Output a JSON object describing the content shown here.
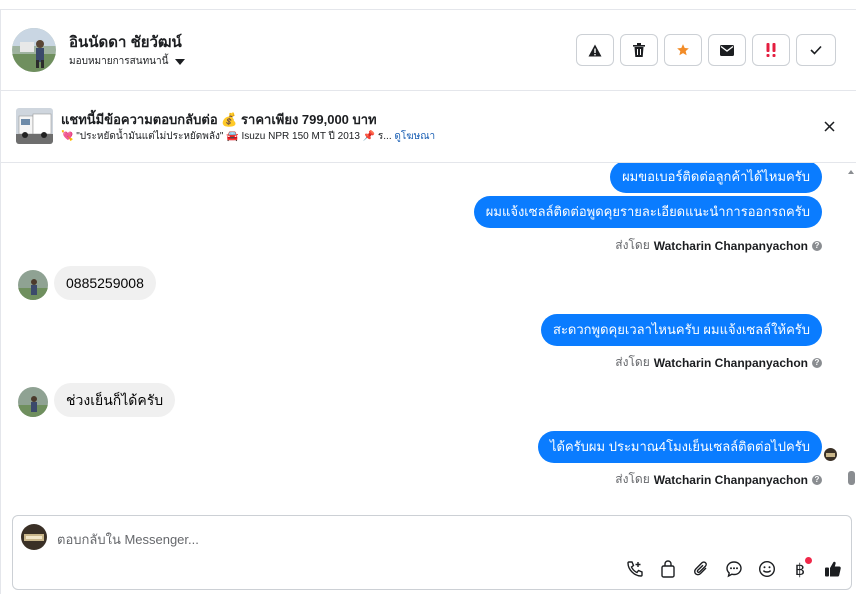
{
  "header": {
    "contact_name": "อินนัดดา ชัยวัฒน์",
    "assign_label": "มอบหมายการสนทนานี้",
    "actions": [
      {
        "name": "report-spam-button",
        "icon": "warning-icon"
      },
      {
        "name": "delete-button",
        "icon": "trash-icon"
      },
      {
        "name": "star-button",
        "icon": "star-icon"
      },
      {
        "name": "mark-unread-button",
        "icon": "envelope-icon"
      },
      {
        "name": "follow-up-button",
        "icon": "double-exclamation-icon"
      },
      {
        "name": "mark-done-button",
        "icon": "checkmark-icon"
      }
    ]
  },
  "ad": {
    "title": "แชทนี้มีข้อความตอบกลับต่อ 💰 ราคาเพียง 799,000 บาท",
    "subtitle": "💘 \"ประหยัดน้ำมันแต่ไม่ประหยัดพลัง\" 🚘 Isuzu NPR 150 MT ปี 2013 📌 ร...",
    "link": "ดูโฆษณา"
  },
  "messages": [
    {
      "direction": "out",
      "text": "ผมขอเบอร์ติดต่อลูกค้าได้ไหมครับ"
    },
    {
      "direction": "out",
      "text": "ผมแจ้งเซลล์ติดต่อพูดคุยรายละเอียดแนะนำการออกรถครับ"
    },
    {
      "direction": "in",
      "text": "0885259008"
    },
    {
      "direction": "out",
      "text": "สะดวกพูดคุยเวลาไหนครับ ผมแจ้งเซลล์ให้ครับ"
    },
    {
      "direction": "in",
      "text": "ช่วงเย็นก็ได้ครับ"
    },
    {
      "direction": "out",
      "text": "ได้ครับผม ประมาณ4โมงเย็นเซลล์ติดต่อไปครับ"
    }
  ],
  "sent_by": {
    "prefix": "ส่งโดย",
    "name": "Watcharin Chanpanyachon"
  },
  "composer": {
    "placeholder": "ตอบกลับใน Messenger...",
    "tools": [
      "phone-plus-icon",
      "shopping-bag-icon",
      "paperclip-icon",
      "chat-bubble-icon",
      "emoji-icon",
      "baht-icon",
      "thumbs-up-icon"
    ]
  },
  "colors": {
    "outgoing_bubble": "#0a7cff",
    "incoming_bubble": "#f0f0f0",
    "star": "#f28c28",
    "alert": "#e41e3f",
    "notification_dot": "#f02849"
  }
}
